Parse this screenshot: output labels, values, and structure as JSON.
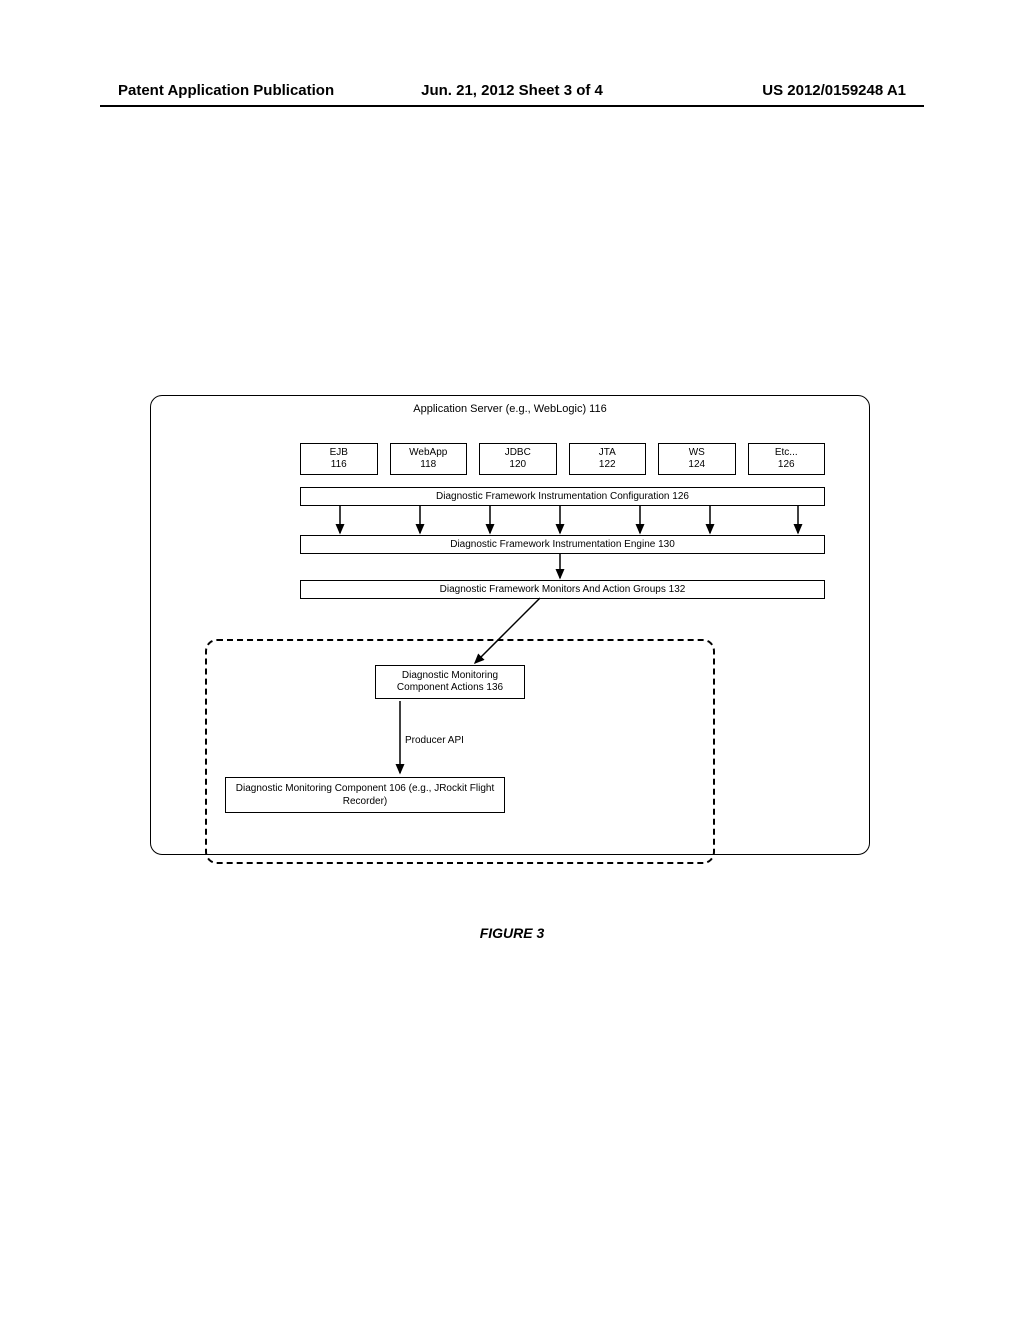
{
  "header": {
    "left": "Patent Application Publication",
    "center": "Jun. 21, 2012  Sheet 3 of 4",
    "right": "US 2012/0159248 A1"
  },
  "diagram": {
    "appServerTitle": "Application Server (e.g., WebLogic) 116",
    "topBoxes": [
      {
        "line1": "EJB",
        "line2": "116"
      },
      {
        "line1": "WebApp",
        "line2": "118"
      },
      {
        "line1": "JDBC",
        "line2": "120"
      },
      {
        "line1": "JTA",
        "line2": "122"
      },
      {
        "line1": "WS",
        "line2": "124"
      },
      {
        "line1": "Etc...",
        "line2": "126"
      }
    ],
    "configBox": "Diagnostic Framework Instrumentation Configuration 126",
    "engineBox": "Diagnostic Framework Instrumentation Engine 130",
    "monitorsBox": "Diagnostic Framework Monitors And Action Groups 132",
    "componentActions": "Diagnostic Monitoring Component Actions 136",
    "producerApi": "Producer API",
    "monitoringComponent": "Diagnostic Monitoring Component 106 (e.g., JRockit Flight Recorder)"
  },
  "figureLabel": "FIGURE 3"
}
